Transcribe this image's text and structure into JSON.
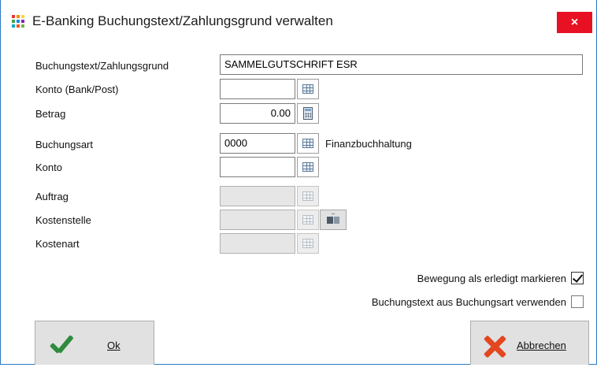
{
  "window": {
    "title": "E-Banking Buchungstext/Zahlungsgrund verwalten",
    "close_glyph": "×",
    "icon": "app-grid-icon",
    "icon_colors": [
      "#e53935",
      "#fb8c00",
      "#fdd835",
      "#43a047",
      "#1e88e5",
      "#8e24aa",
      "#00acc1",
      "#f4511e",
      "#7cb342"
    ]
  },
  "form": {
    "buchungstext": {
      "label": "Buchungstext/Zahlungsgrund",
      "value": "SAMMELGUTSCHRIFT ESR"
    },
    "konto_bank_post": {
      "label": "Konto (Bank/Post)",
      "value": ""
    },
    "betrag": {
      "label": "Betrag",
      "value": "0.00"
    },
    "buchungsart": {
      "label": "Buchungsart",
      "value": "0000",
      "description": "Finanzbuchhaltung"
    },
    "konto": {
      "label": "Konto",
      "value": ""
    },
    "auftrag": {
      "label": "Auftrag",
      "value": ""
    },
    "kostenstelle": {
      "label": "Kostenstelle",
      "value": ""
    },
    "kostenart": {
      "label": "Kostenart",
      "value": ""
    }
  },
  "options": {
    "erledigt": {
      "label": "Bewegung als erledigt markieren",
      "checked": true
    },
    "buchungstext_aus_buchungsart": {
      "label": "Buchungstext aus Buchungsart verwenden",
      "checked": false
    }
  },
  "buttons": {
    "ok": {
      "label": "Ok",
      "icon": "checkmark-icon"
    },
    "cancel": {
      "label": "Abbrechen",
      "icon": "x-icon"
    }
  },
  "colors": {
    "close_bg": "#e81123",
    "window_border": "#2b78c5",
    "ok_icon": "#2e8b3e",
    "cancel_icon": "#e2471f"
  }
}
